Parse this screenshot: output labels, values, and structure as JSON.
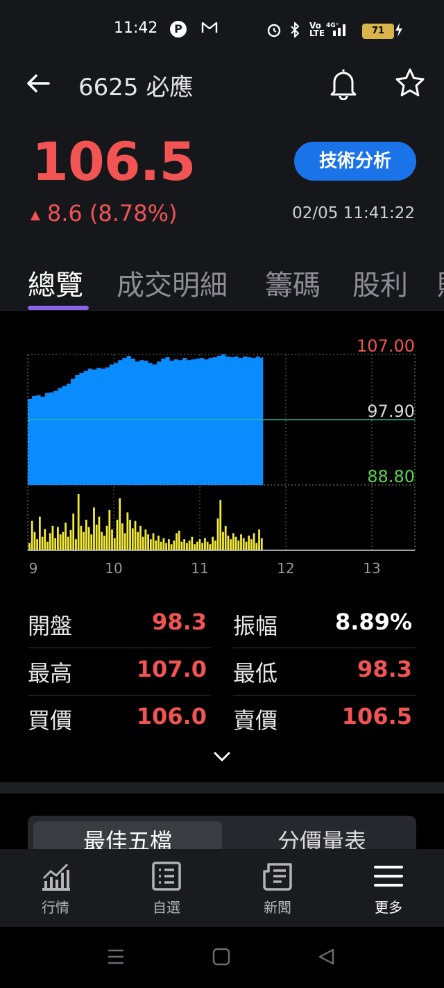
{
  "status_bar": {
    "time": "11:42",
    "battery": "71"
  },
  "header": {
    "title": "6625 必應"
  },
  "quote": {
    "price": "106.5",
    "change": "8.6 (8.78%)",
    "timestamp": "02/05 11:41:22",
    "tech_button": "技術分析"
  },
  "tabs": [
    {
      "label": "總覽"
    },
    {
      "label": "成交明細"
    },
    {
      "label": "籌碼"
    },
    {
      "label": "股利"
    }
  ],
  "chart_data": {
    "type": "area",
    "y_labels": {
      "high": "107.00",
      "ref": "97.90",
      "low": "88.80"
    },
    "x_ticks": [
      "9",
      "10",
      "11",
      "12",
      "13"
    ],
    "ylim": [
      88.8,
      107.0
    ],
    "price_series": [
      [
        9.0,
        100.8
      ],
      [
        9.05,
        101.2
      ],
      [
        9.1,
        101.3
      ],
      [
        9.15,
        101.1
      ],
      [
        9.2,
        101.6
      ],
      [
        9.25,
        101.7
      ],
      [
        9.3,
        101.9
      ],
      [
        9.35,
        102.3
      ],
      [
        9.4,
        102.6
      ],
      [
        9.45,
        102.9
      ],
      [
        9.5,
        103.6
      ],
      [
        9.55,
        104.1
      ],
      [
        9.6,
        104.4
      ],
      [
        9.65,
        104.7
      ],
      [
        9.7,
        105.0
      ],
      [
        9.75,
        104.9
      ],
      [
        9.8,
        105.1
      ],
      [
        9.85,
        105.0
      ],
      [
        9.9,
        105.2
      ],
      [
        9.95,
        105.6
      ],
      [
        10.0,
        105.8
      ],
      [
        10.05,
        106.2
      ],
      [
        10.1,
        106.5
      ],
      [
        10.15,
        106.8
      ],
      [
        10.2,
        106.4
      ],
      [
        10.25,
        106.0
      ],
      [
        10.3,
        106.2
      ],
      [
        10.35,
        106.1
      ],
      [
        10.4,
        105.8
      ],
      [
        10.45,
        105.6
      ],
      [
        10.5,
        106.0
      ],
      [
        10.55,
        106.4
      ],
      [
        10.6,
        106.6
      ],
      [
        10.65,
        106.1
      ],
      [
        10.7,
        106.3
      ],
      [
        10.75,
        106.2
      ],
      [
        10.8,
        106.5
      ],
      [
        10.85,
        106.2
      ],
      [
        10.9,
        106.3
      ],
      [
        10.95,
        106.4
      ],
      [
        11.0,
        106.5
      ],
      [
        11.05,
        106.3
      ],
      [
        11.1,
        106.5
      ],
      [
        11.15,
        106.6
      ],
      [
        11.2,
        106.8
      ],
      [
        11.25,
        107.0
      ],
      [
        11.3,
        106.7
      ],
      [
        11.35,
        106.6
      ],
      [
        11.4,
        106.7
      ],
      [
        11.45,
        106.5
      ],
      [
        11.5,
        106.7
      ],
      [
        11.55,
        106.6
      ],
      [
        11.6,
        106.5
      ],
      [
        11.65,
        106.7
      ],
      [
        11.7,
        106.5
      ],
      [
        11.72,
        106.6
      ]
    ],
    "volume_series": [
      [
        9.02,
        12
      ],
      [
        9.05,
        48
      ],
      [
        9.08,
        30
      ],
      [
        9.11,
        18
      ],
      [
        9.14,
        55
      ],
      [
        9.17,
        22
      ],
      [
        9.2,
        35
      ],
      [
        9.23,
        14
      ],
      [
        9.26,
        28
      ],
      [
        9.29,
        40
      ],
      [
        9.32,
        20
      ],
      [
        9.35,
        38
      ],
      [
        9.38,
        26
      ],
      [
        9.41,
        30
      ],
      [
        9.44,
        45
      ],
      [
        9.47,
        22
      ],
      [
        9.5,
        33
      ],
      [
        9.53,
        60
      ],
      [
        9.56,
        18
      ],
      [
        9.59,
        92
      ],
      [
        9.62,
        40
      ],
      [
        9.65,
        30
      ],
      [
        9.68,
        50
      ],
      [
        9.71,
        38
      ],
      [
        9.74,
        26
      ],
      [
        9.77,
        70
      ],
      [
        9.8,
        42
      ],
      [
        9.83,
        55
      ],
      [
        9.86,
        30
      ],
      [
        9.89,
        24
      ],
      [
        9.92,
        40
      ],
      [
        9.95,
        66
      ],
      [
        9.98,
        34
      ],
      [
        10.01,
        20
      ],
      [
        10.04,
        50
      ],
      [
        10.07,
        85
      ],
      [
        10.1,
        44
      ],
      [
        10.13,
        28
      ],
      [
        10.16,
        62
      ],
      [
        10.19,
        50
      ],
      [
        10.22,
        36
      ],
      [
        10.25,
        48
      ],
      [
        10.28,
        30
      ],
      [
        10.31,
        40
      ],
      [
        10.34,
        22
      ],
      [
        10.37,
        34
      ],
      [
        10.4,
        26
      ],
      [
        10.43,
        18
      ],
      [
        10.46,
        28
      ],
      [
        10.49,
        16
      ],
      [
        10.52,
        24
      ],
      [
        10.55,
        14
      ],
      [
        10.58,
        20
      ],
      [
        10.61,
        12
      ],
      [
        10.64,
        18
      ],
      [
        10.67,
        10
      ],
      [
        10.7,
        16
      ],
      [
        10.73,
        28
      ],
      [
        10.76,
        32
      ],
      [
        10.79,
        14
      ],
      [
        10.82,
        18
      ],
      [
        10.85,
        12
      ],
      [
        10.88,
        16
      ],
      [
        10.91,
        22
      ],
      [
        10.94,
        10
      ],
      [
        10.97,
        14
      ],
      [
        11.0,
        18
      ],
      [
        11.03,
        12
      ],
      [
        11.06,
        20
      ],
      [
        11.09,
        14
      ],
      [
        11.12,
        10
      ],
      [
        11.15,
        22
      ],
      [
        11.18,
        16
      ],
      [
        11.21,
        52
      ],
      [
        11.24,
        82
      ],
      [
        11.27,
        30
      ],
      [
        11.3,
        40
      ],
      [
        11.33,
        24
      ],
      [
        11.36,
        18
      ],
      [
        11.39,
        28
      ],
      [
        11.42,
        22
      ],
      [
        11.45,
        16
      ],
      [
        11.48,
        26
      ],
      [
        11.51,
        20
      ],
      [
        11.54,
        14
      ],
      [
        11.57,
        24
      ],
      [
        11.6,
        18
      ],
      [
        11.63,
        28
      ],
      [
        11.66,
        12
      ],
      [
        11.69,
        34
      ],
      [
        11.72,
        20
      ]
    ]
  },
  "stats": [
    {
      "label": "開盤",
      "value": "98.3",
      "color": "#f25454"
    },
    {
      "label": "振幅",
      "value": "8.89%",
      "color": "#ffffff"
    },
    {
      "label": "最高",
      "value": "107.0",
      "color": "#f25454"
    },
    {
      "label": "最低",
      "value": "98.3",
      "color": "#f25454"
    },
    {
      "label": "買價",
      "value": "106.0",
      "color": "#f25454"
    },
    {
      "label": "賣價",
      "value": "106.5",
      "color": "#f25454"
    }
  ],
  "order_book_tabs": {
    "best_five": "最佳五檔",
    "price_volume": "分價量表"
  },
  "bottom_nav": [
    {
      "label": "行情",
      "icon": "chart-icon"
    },
    {
      "label": "自選",
      "icon": "list-icon"
    },
    {
      "label": "新聞",
      "icon": "news-icon"
    },
    {
      "label": "更多",
      "icon": "menu-icon"
    }
  ],
  "colors": {
    "up": "#f25454",
    "down": "#5bd44a",
    "area": "#0a8cff",
    "volume": "#f3ea3a",
    "accent": "#1a73e8",
    "tab_indicator": "#8a63e8"
  }
}
